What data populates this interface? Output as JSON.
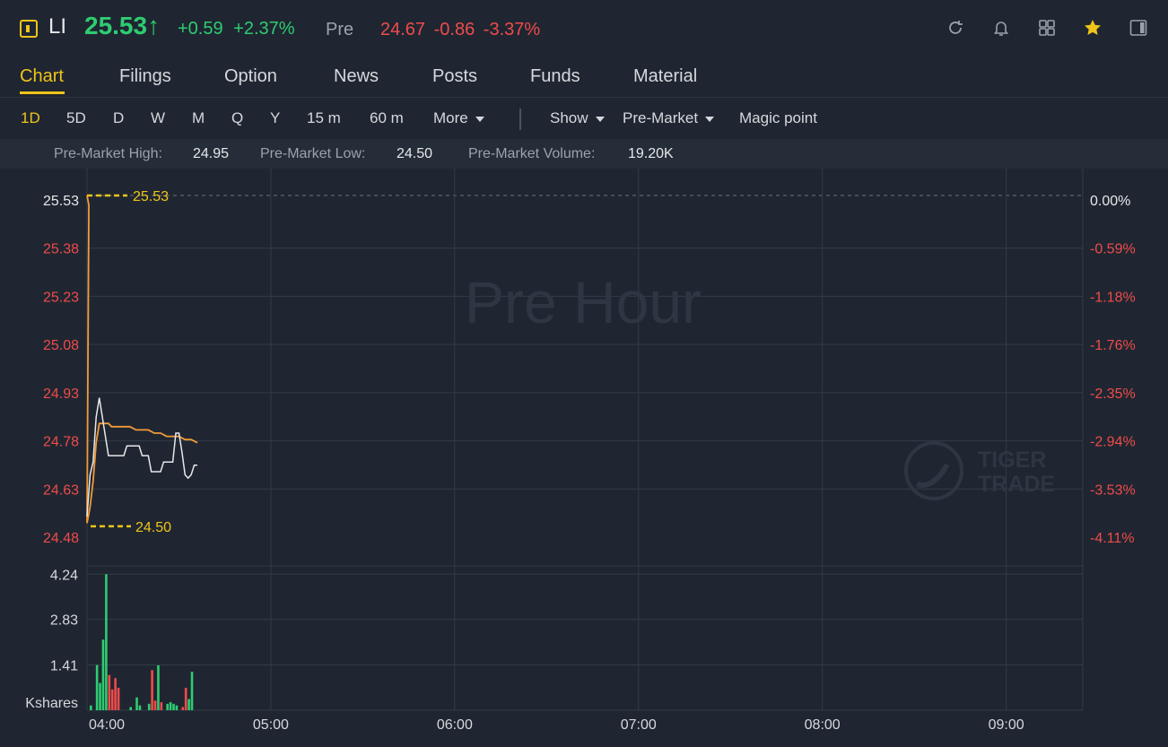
{
  "header": {
    "symbol": "LI",
    "last_price": "25.53↑",
    "change": "+0.59",
    "change_pct": "+2.37%",
    "pre_label": "Pre",
    "pre_price": "24.67",
    "pre_change": "-0.86",
    "pre_change_pct": "-3.37%",
    "icons": [
      "refresh-icon",
      "bell-icon",
      "grid-icon",
      "star-icon",
      "panel-icon"
    ]
  },
  "tabs": [
    "Chart",
    "Filings",
    "Option",
    "News",
    "Posts",
    "Funds",
    "Material"
  ],
  "active_tab": "Chart",
  "toolbar": {
    "periods": [
      "1D",
      "5D",
      "D",
      "W",
      "M",
      "Q",
      "Y",
      "15 m",
      "60 m"
    ],
    "active_period": "1D",
    "more": "More",
    "show": "Show",
    "pre_market": "Pre-Market",
    "magic_point": "Magic point"
  },
  "stats": {
    "high_label": "Pre-Market High:",
    "high": "24.95",
    "low_label": "Pre-Market Low:",
    "low": "24.50",
    "volume_label": "Pre-Market Volume:",
    "volume": "19.20K"
  },
  "colors": {
    "up": "#2ecc71",
    "down": "#ef4b4b",
    "accent": "#f0c419",
    "avg_line": "#f29a38",
    "price_line": "#e6e8eb"
  },
  "chart_data": {
    "type": "line",
    "watermark": "Pre Hour",
    "brand_watermark": [
      "TIGER",
      "TRADE"
    ],
    "price_axis": {
      "ticks": [
        "25.53",
        "25.38",
        "25.23",
        "25.08",
        "24.93",
        "24.78",
        "24.63",
        "24.48"
      ],
      "ylim": [
        24.48,
        25.53
      ]
    },
    "pct_axis": {
      "ticks": [
        "0.00%",
        "-0.59%",
        "-1.18%",
        "-1.76%",
        "-2.35%",
        "-2.94%",
        "-3.53%",
        "-4.11%"
      ]
    },
    "time_axis": {
      "ticks": [
        "04:00",
        "05:00",
        "06:00",
        "07:00",
        "08:00",
        "09:00"
      ],
      "xlim_minutes": [
        0,
        325
      ]
    },
    "marker_high": "25.53",
    "marker_low": "24.50",
    "series": [
      {
        "minutes": [
          0,
          1,
          2,
          3,
          4,
          5,
          6,
          7,
          8,
          9,
          10,
          11,
          12,
          13,
          14,
          15,
          16,
          17,
          18,
          19,
          20,
          21,
          22,
          23,
          24,
          25,
          26,
          27,
          28,
          29,
          30,
          31,
          32,
          33,
          34,
          35,
          36
        ],
        "values": [
          24.53,
          24.66,
          24.7,
          24.84,
          24.9,
          24.84,
          24.78,
          24.72,
          24.72,
          24.72,
          24.72,
          24.72,
          24.72,
          24.75,
          24.75,
          24.75,
          24.75,
          24.75,
          24.72,
          24.72,
          24.72,
          24.67,
          24.67,
          24.67,
          24.67,
          24.7,
          24.7,
          24.7,
          24.7,
          24.79,
          24.79,
          24.73,
          24.66,
          24.65,
          24.66,
          24.69,
          24.69
        ]
      },
      {
        "minutes": [
          0,
          1,
          2,
          3,
          4,
          5,
          6,
          7,
          8,
          10,
          12,
          14,
          16,
          18,
          20,
          22,
          24,
          26,
          28,
          30,
          32,
          34,
          36
        ],
        "values": [
          24.51,
          24.56,
          24.64,
          24.76,
          24.82,
          24.82,
          24.82,
          24.82,
          24.81,
          24.81,
          24.81,
          24.81,
          24.8,
          24.8,
          24.8,
          24.79,
          24.79,
          24.78,
          24.78,
          24.78,
          24.77,
          24.77,
          24.76
        ]
      }
    ],
    "volume": {
      "axis_ticks": [
        "4.24",
        "2.83",
        "1.41",
        "Kshares"
      ],
      "ylim": [
        0,
        4.5
      ],
      "bars": [
        [
          0,
          0.15,
          "up"
        ],
        [
          2,
          1.41,
          "up"
        ],
        [
          3,
          0.85,
          "up"
        ],
        [
          4,
          2.2,
          "up"
        ],
        [
          5,
          4.24,
          "up"
        ],
        [
          6,
          1.1,
          "down"
        ],
        [
          7,
          0.65,
          "down"
        ],
        [
          8,
          1.0,
          "down"
        ],
        [
          9,
          0.7,
          "down"
        ],
        [
          13,
          0.1,
          "up"
        ],
        [
          15,
          0.4,
          "up"
        ],
        [
          16,
          0.15,
          "up"
        ],
        [
          19,
          0.2,
          "up"
        ],
        [
          20,
          1.25,
          "down"
        ],
        [
          21,
          0.3,
          "down"
        ],
        [
          22,
          1.4,
          "up"
        ],
        [
          23,
          0.25,
          "down"
        ],
        [
          25,
          0.2,
          "up"
        ],
        [
          26,
          0.25,
          "up"
        ],
        [
          27,
          0.2,
          "up"
        ],
        [
          28,
          0.15,
          "up"
        ],
        [
          30,
          0.1,
          "down"
        ],
        [
          31,
          0.7,
          "down"
        ],
        [
          32,
          0.35,
          "up"
        ],
        [
          33,
          1.2,
          "up"
        ]
      ]
    }
  }
}
